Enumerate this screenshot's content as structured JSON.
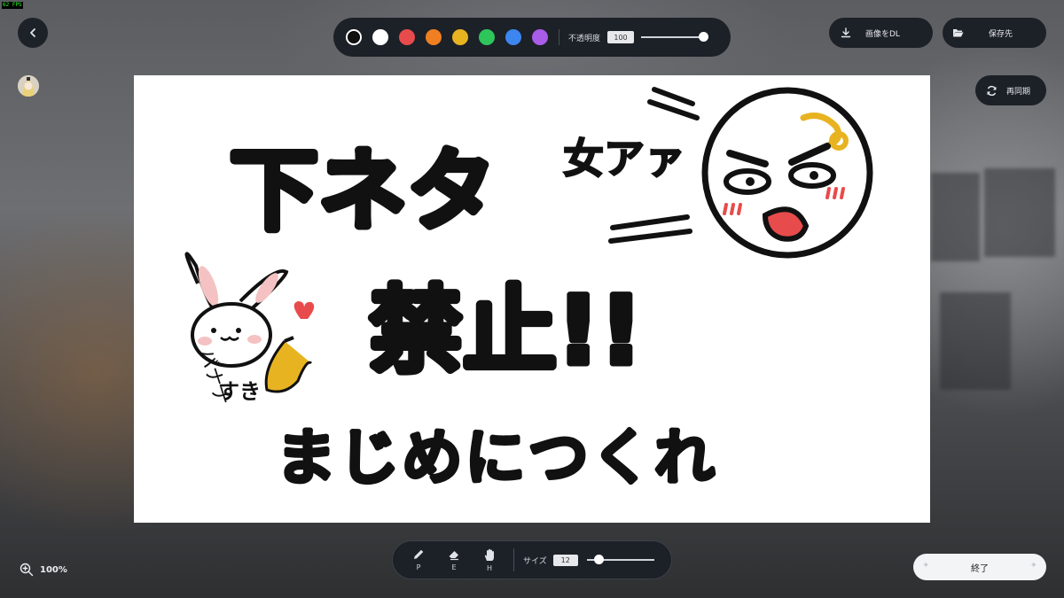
{
  "fps": "62 FPS",
  "palette": {
    "colors": [
      "#111111",
      "#ffffff",
      "#e84b4b",
      "#f07f22",
      "#e8b320",
      "#2ec55b",
      "#3d86f0",
      "#a95ce8"
    ],
    "selected_index": 0,
    "opacity_label": "不透明度",
    "opacity_value": "100",
    "opacity_level": 1.0
  },
  "header": {
    "download_label": "画像をDL",
    "save_label": "保存先",
    "sync_label": "再同期"
  },
  "drawing": {
    "text_main_1": "下ネタ",
    "text_main_2": "禁止!!",
    "text_main_3": "まじめにつくれ",
    "text_side": "女アァ",
    "text_small_1": "バナナ",
    "text_small_2": "すき"
  },
  "tools": [
    {
      "key": "P",
      "icon": "pencil-icon"
    },
    {
      "key": "E",
      "icon": "eraser-icon"
    },
    {
      "key": "H",
      "icon": "hand-icon"
    }
  ],
  "size": {
    "label": "サイズ",
    "value": "12",
    "level": 0.12
  },
  "zoom": {
    "value": "100%"
  },
  "end_label": "終了"
}
